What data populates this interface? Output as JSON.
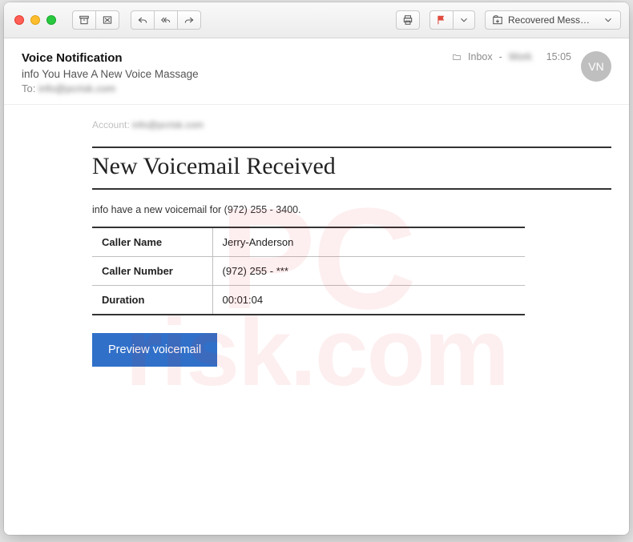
{
  "toolbar": {
    "move_to_label": "Recovered Mess…"
  },
  "header": {
    "sender": "Voice Notification",
    "subject": "info You Have A New Voice Massage",
    "to_label": "To:",
    "to_value": "info@pcrisk.com",
    "folder": "Inbox",
    "folder_dash": " - ",
    "account_blur": "Work",
    "time": "15:05",
    "avatar_initials": "VN"
  },
  "body": {
    "account_label": "Account:",
    "account_value": "info@pcrisk.com",
    "title": "New Voicemail Received",
    "intro": "info have a new voicemail for (972) 255 - 3400.",
    "rows": [
      {
        "k": "Caller Name",
        "v": "Jerry-Anderson"
      },
      {
        "k": "Caller Number",
        "v": "(972) 255 - ***"
      },
      {
        "k": "Duration",
        "v": "00:01:04"
      }
    ],
    "cta": "Preview voicemail"
  },
  "watermark": {
    "line1": "PC",
    "line2": "risk.com"
  }
}
